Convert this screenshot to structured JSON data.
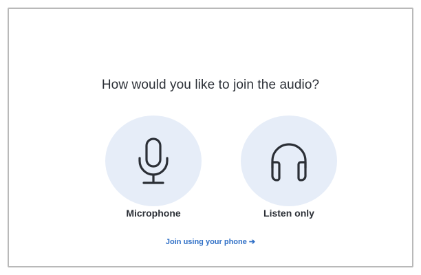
{
  "dialog": {
    "title": "How would you like to join the audio?",
    "options": [
      {
        "label": "Microphone",
        "icon": "microphone-icon"
      },
      {
        "label": "Listen only",
        "icon": "headphones-icon"
      }
    ],
    "phone_link": {
      "label": "Join using your phone",
      "arrow": "➔"
    }
  },
  "colors": {
    "circle_bg": "#e6edf8",
    "link": "#2f6fc6",
    "text": "#2b2f36",
    "border": "#b9b9b9"
  }
}
